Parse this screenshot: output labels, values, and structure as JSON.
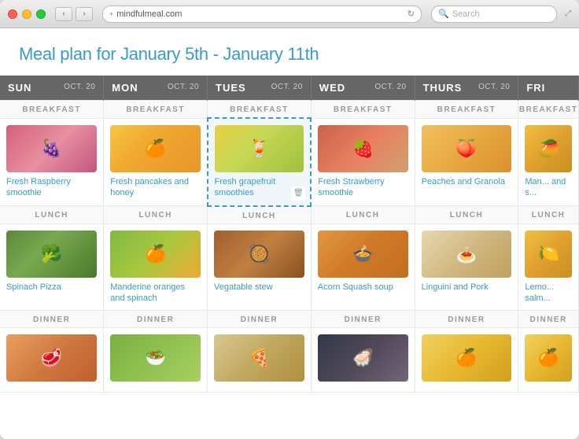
{
  "window": {
    "title": "mindfulmeal.com",
    "url": "mindfulmeal.com"
  },
  "page": {
    "title": "Meal plan for January 5th - January 11th"
  },
  "days": [
    {
      "id": "sun",
      "name": "SUN",
      "date": "OCT. 20"
    },
    {
      "id": "mon",
      "name": "MON",
      "date": "OCT. 20"
    },
    {
      "id": "tues",
      "name": "TUES",
      "date": "OCT. 20"
    },
    {
      "id": "wed",
      "name": "WED",
      "date": "OCT. 20"
    },
    {
      "id": "thurs",
      "name": "THURS",
      "date": "OCT. 20"
    },
    {
      "id": "fri",
      "name": "FRI",
      "date": ""
    }
  ],
  "sections": [
    "BREAKFAST",
    "LUNCH",
    "DINNER"
  ],
  "meals": {
    "breakfast": [
      {
        "name": "Fresh Raspberry smoothie",
        "imgClass": "img-raspberry",
        "icon": "🍇"
      },
      {
        "name": "Fresh pancakes and honey",
        "imgClass": "img-pancakes",
        "icon": "🍊"
      },
      {
        "name": "Fresh grapefruit smoothies",
        "imgClass": "img-grapefruit",
        "icon": "🍹",
        "highlighted": true,
        "showDelete": true
      },
      {
        "name": "Fresh Strawberry smoothie",
        "imgClass": "img-strawberry",
        "icon": "🍓"
      },
      {
        "name": "Peaches and Granola",
        "imgClass": "img-peaches",
        "icon": "🍑"
      },
      {
        "name": "Man... and s...",
        "imgClass": "img-fri-mango",
        "icon": "🥭",
        "partial": true
      }
    ],
    "lunch": [
      {
        "name": "Spinach Pizza",
        "imgClass": "img-spinach",
        "icon": "🥦"
      },
      {
        "name": "Manderine oranges and spinach",
        "imgClass": "img-mandarine",
        "icon": "🍊"
      },
      {
        "name": "Vegatable stew",
        "imgClass": "img-vegstew",
        "icon": "🥘"
      },
      {
        "name": "Acorn Squash soup",
        "imgClass": "img-acorn",
        "icon": "🍲"
      },
      {
        "name": "Linguini and Pork",
        "imgClass": "img-linguini",
        "icon": "🍝"
      },
      {
        "name": "Lemo... salm...",
        "imgClass": "img-fri-mango",
        "icon": "🍋",
        "partial": true
      }
    ],
    "dinner": [
      {
        "name": "",
        "imgClass": "img-dinner1",
        "icon": "🥩"
      },
      {
        "name": "",
        "imgClass": "img-dinner2",
        "icon": "🥗"
      },
      {
        "name": "",
        "imgClass": "img-dinner3",
        "icon": "🍕"
      },
      {
        "name": "",
        "imgClass": "img-dinner4",
        "icon": "🦪"
      },
      {
        "name": "",
        "imgClass": "img-dinner5",
        "icon": "🍊"
      },
      {
        "name": "",
        "imgClass": "img-dinner5",
        "icon": "🍊",
        "partial": true
      }
    ]
  },
  "labels": {
    "breakfast": "BREAKFAST",
    "lunch": "LUNCH",
    "dinner": "DINNER",
    "search_placeholder": "Search",
    "nav_back": "‹",
    "nav_forward": "›"
  }
}
